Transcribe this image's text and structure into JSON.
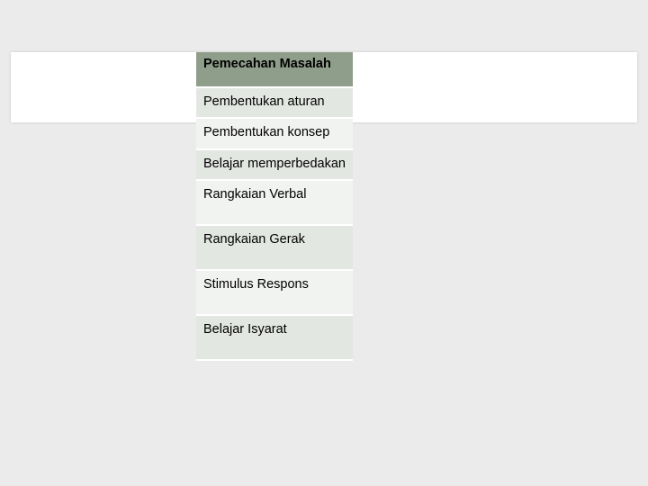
{
  "rows": {
    "r0": "Pemecahan Masalah",
    "r1": "Pembentukan aturan",
    "r2": "Pembentukan konsep",
    "r3": "Belajar memperbedakan",
    "r4": "Rangkaian Verbal",
    "r5": "Rangkaian Gerak",
    "r6": "Stimulus Respons",
    "r7": "Belajar Isyarat"
  }
}
